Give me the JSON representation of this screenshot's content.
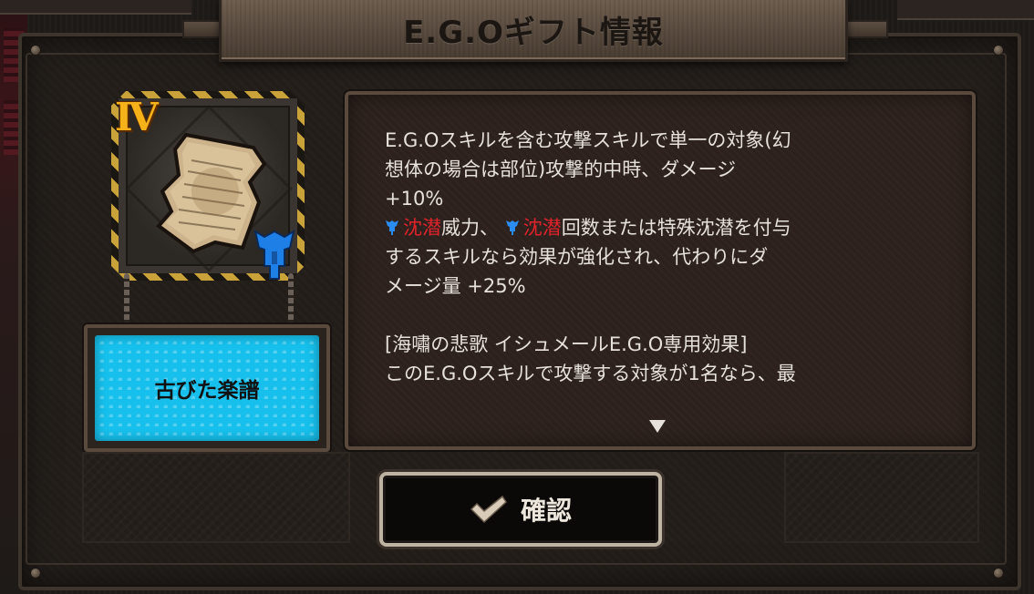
{
  "dialog": {
    "title": "E.G.Oギフト情報"
  },
  "gift": {
    "grade": "Ⅳ",
    "name": "古びた楽譜",
    "grade_color": "#f5b319",
    "name_plate_color": "#17c0ec",
    "icon": "torn-sheet-music-icon",
    "attribute_icon": "blue-tremor-keyword-icon"
  },
  "description": {
    "line1": "E.G.Oスキルを含む攻撃スキルで単一の対象(幻",
    "line2": "想体の場合は部位)攻撃的中時、ダメージ",
    "line3": "+10%",
    "kw1": "沈潜",
    "line4a": "威力、",
    "kw2": "沈潜",
    "line4b": "回数または特殊沈潜を付与",
    "line5": "するスキルなら効果が強化され、代わりにダ",
    "line6": "メージ量 +25%",
    "line7": "[海嘯の悲歌 イシュメールE.G.O専用効果]",
    "line8": "このE.G.Oスキルで攻撃する対象が1名なら、最",
    "keyword_color": "#e0232b"
  },
  "actions": {
    "confirm_label": "確認",
    "confirm_icon": "checkmark-icon"
  }
}
